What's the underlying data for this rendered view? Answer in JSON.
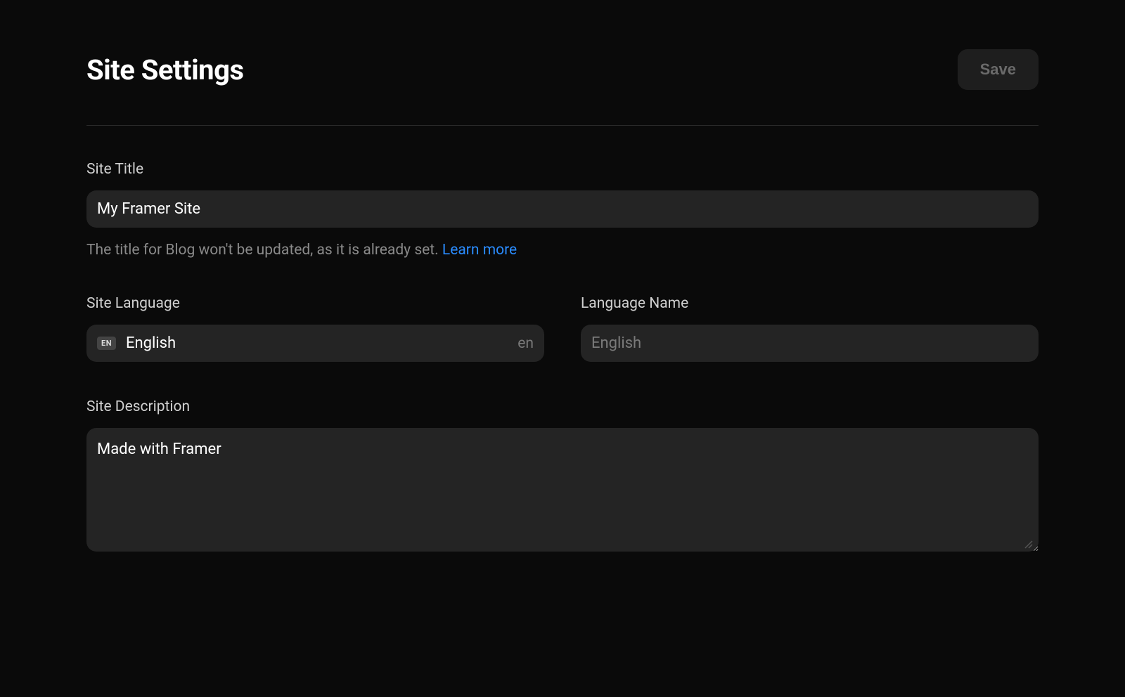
{
  "header": {
    "title": "Site Settings",
    "save_label": "Save"
  },
  "site_title": {
    "label": "Site Title",
    "value": "My Framer Site",
    "helper": "The title for Blog won't be updated, as it is already set. ",
    "learn_more": "Learn more"
  },
  "site_language": {
    "label": "Site Language",
    "badge": "EN",
    "value": "English",
    "code": "en"
  },
  "language_name": {
    "label": "Language Name",
    "placeholder": "English"
  },
  "site_description": {
    "label": "Site Description",
    "value": "Made with Framer"
  }
}
